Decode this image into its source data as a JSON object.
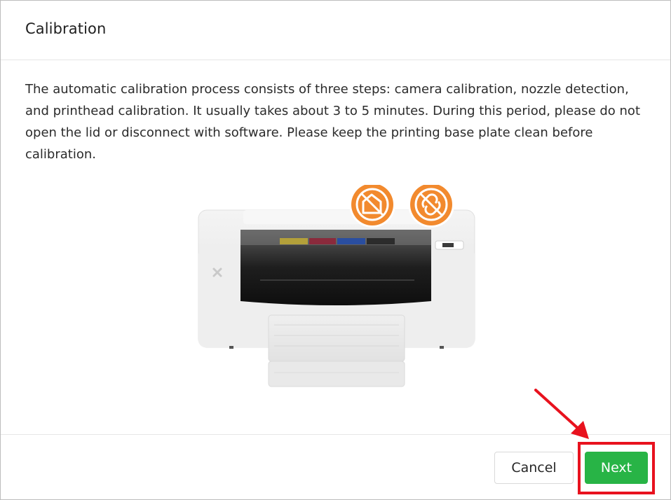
{
  "dialog": {
    "title": "Calibration",
    "description": "The automatic calibration process consists of three steps: camera calibration, nozzle detection, and printhead calibration. It usually takes about 3 to 5 minutes. During this period, please do not open the lid or disconnect with software. Please keep the printing base plate clean before calibration."
  },
  "illustration": {
    "icons": [
      "no-open-lid-icon",
      "no-disconnect-icon"
    ],
    "badge_color": "#f28a2e"
  },
  "footer": {
    "cancel_label": "Cancel",
    "next_label": "Next"
  },
  "annotation": {
    "highlight_color": "#e8121e",
    "accent": "#28b446"
  }
}
